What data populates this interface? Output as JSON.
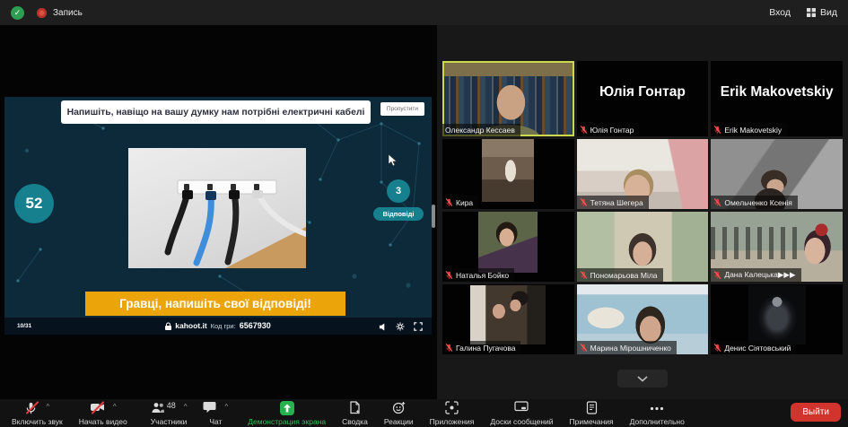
{
  "colors": {
    "teal": "#16808f",
    "kahoot_bg": "#0d2a3a",
    "banner_yellow": "#eca40b",
    "share_green": "#27b04e",
    "exit_red": "#d0342c",
    "active_border": "#ccd94e",
    "muted_red": "#e23b3b"
  },
  "top_bar": {
    "record_label": "Запись",
    "login_label": "Вход",
    "view_label": "Вид"
  },
  "slide": {
    "question": "Напишіть, навіщо на вашу думку нам потрібні електричні кабелі",
    "skip_label": "Пропустити",
    "timer": "52",
    "answers_count": "3",
    "answers_label": "Відповіді",
    "banner": "Гравці, напишіть свої відповіді!",
    "page": "10/31",
    "site": "kahoot.it",
    "pin_label": "Код гри:",
    "pin": "6567930"
  },
  "participants": [
    {
      "name": "Олександр Кессаев",
      "muted": false,
      "camera": "on",
      "active": true
    },
    {
      "name": "Юлія Гонтар",
      "muted": true,
      "camera": "off-name"
    },
    {
      "name": "Erik Makovetskiy",
      "muted": true,
      "camera": "off-name"
    },
    {
      "name": "Кира",
      "muted": true,
      "camera": "avatar"
    },
    {
      "name": "Тетяна Шегера",
      "muted": true,
      "camera": "on"
    },
    {
      "name": "Омельченко Ксенія",
      "muted": true,
      "camera": "on"
    },
    {
      "name": "Наталья Бойко",
      "muted": true,
      "camera": "avatar"
    },
    {
      "name": "Пономарьова Міла",
      "muted": true,
      "camera": "on"
    },
    {
      "name": "Дана Калецька▶▶▶",
      "muted": true,
      "camera": "on"
    },
    {
      "name": "Галина Пугачова",
      "muted": true,
      "camera": "avatar"
    },
    {
      "name": "Марина Мірошниченко",
      "muted": true,
      "camera": "on"
    },
    {
      "name": "Денис Сіятовський",
      "muted": true,
      "camera": "avatar"
    }
  ],
  "toolbar": {
    "items": [
      {
        "label": "Включить звук"
      },
      {
        "label": "Начать видео"
      },
      {
        "label": "Участники",
        "badge": "48"
      },
      {
        "label": "Чат"
      },
      {
        "label": "Демонстрация экрана"
      },
      {
        "label": "Сводка"
      },
      {
        "label": "Реакции"
      },
      {
        "label": "Приложения"
      },
      {
        "label": "Доски сообщений"
      },
      {
        "label": "Примечания"
      },
      {
        "label": "Дополнительно"
      },
      {
        "label": "Выйти"
      }
    ]
  },
  "icons": {
    "shield-check": "green circle with check",
    "record": "red dot",
    "view-grid": "grid squares",
    "mic-muted": "microphone with red slash",
    "camera-muted": "camera with red slash",
    "participants": "two people",
    "chat": "speech bubble",
    "screen-share": "green square with up arrow",
    "summary": "document with sparkle",
    "reactions": "smiley with plus",
    "apps": "corner brackets with dot",
    "whiteboard": "board",
    "notes": "notebook",
    "more": "ellipsis",
    "chevron-down": "⌄",
    "lock": "padlock",
    "volume": "speaker",
    "settings": "gear",
    "fullscreen": "expand brackets"
  }
}
